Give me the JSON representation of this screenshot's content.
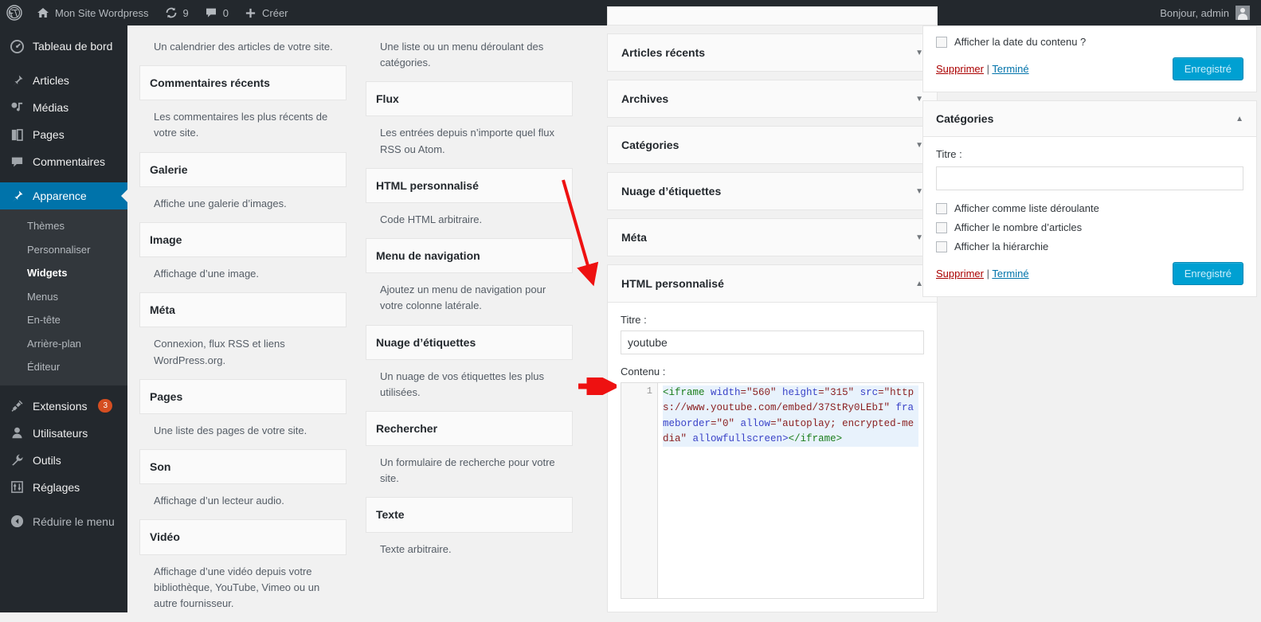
{
  "adminbar": {
    "site_name": "Mon Site Wordpress",
    "updates_count": "9",
    "comments_count": "0",
    "new_label": "Créer",
    "greeting": "Bonjour, admin"
  },
  "sidebar": {
    "items": [
      {
        "label": "Tableau de bord",
        "icon": "dashboard-icon"
      },
      {
        "label": "Articles",
        "icon": "pin-icon"
      },
      {
        "label": "Médias",
        "icon": "media-icon"
      },
      {
        "label": "Pages",
        "icon": "pages-icon"
      },
      {
        "label": "Commentaires",
        "icon": "comment-icon"
      },
      {
        "label": "Apparence",
        "icon": "brush-icon"
      }
    ],
    "appearance_submenu": [
      "Thèmes",
      "Personnaliser",
      "Widgets",
      "Menus",
      "En-tête",
      "Arrière-plan",
      "Éditeur"
    ],
    "current_submenu": "Widgets",
    "items_bottom": [
      {
        "label": "Extensions",
        "icon": "plug-icon",
        "badge": "3"
      },
      {
        "label": "Utilisateurs",
        "icon": "user-icon",
        "badge": ""
      },
      {
        "label": "Outils",
        "icon": "wrench-icon",
        "badge": ""
      },
      {
        "label": "Réglages",
        "icon": "sliders-icon",
        "badge": ""
      }
    ],
    "collapse_label": "Réduire le menu"
  },
  "available_widgets": {
    "left_column": [
      {
        "title": "",
        "desc": "Un calendrier des articles de votre site.",
        "title_hidden": true
      },
      {
        "title": "Commentaires récents",
        "desc": "Les commentaires les plus récents de votre site."
      },
      {
        "title": "Galerie",
        "desc": "Affiche une galerie d’images."
      },
      {
        "title": "Image",
        "desc": "Affichage d’une image."
      },
      {
        "title": "Méta",
        "desc": "Connexion, flux RSS et liens WordPress.org."
      },
      {
        "title": "Pages",
        "desc": "Une liste des pages de votre site."
      },
      {
        "title": "Son",
        "desc": "Affichage d’un lecteur audio."
      },
      {
        "title": "Vidéo",
        "desc": "Affichage d’une vidéo depuis votre bibliothèque, YouTube, Vimeo ou un autre fournisseur."
      }
    ],
    "right_column": [
      {
        "title": "",
        "desc": "Une liste ou un menu déroulant des catégories.",
        "title_hidden": true
      },
      {
        "title": "Flux",
        "desc": "Les entrées depuis n’importe quel flux RSS ou Atom."
      },
      {
        "title": "HTML personnalisé",
        "desc": "Code HTML arbitraire."
      },
      {
        "title": "Menu de navigation",
        "desc": "Ajoutez un menu de navigation pour votre colonne latérale."
      },
      {
        "title": "Nuage d’étiquettes",
        "desc": "Un nuage de vos étiquettes les plus utilisées."
      },
      {
        "title": "Rechercher",
        "desc": "Un formulaire de recherche pour votre site."
      },
      {
        "title": "Texte",
        "desc": "Texte arbitraire."
      }
    ]
  },
  "sidebar_widgets": {
    "collapsed": [
      "Articles récents",
      "Archives",
      "Catégories",
      "Nuage d’étiquettes",
      "Méta"
    ],
    "open_widget": {
      "title": "HTML personnalisé",
      "title_label": "Titre :",
      "title_value": "youtube",
      "content_label": "Contenu :",
      "line_number": "1",
      "code": {
        "t1": "<iframe",
        "a1": " width",
        "v1": "=\"560\"",
        "a2": " height",
        "v2": "=\"315\"",
        "a3": "src",
        "v3": "=\"https://www.youtube.com/embed/37StRy0LEbI\"",
        "a4": " frameborder",
        "v4": "=\"0\"",
        "a5": "allow",
        "v5": "=\"autoplay; encrypted-media\"",
        "a6": "allowfullscreen",
        "p1": ">",
        "t2": "</iframe>"
      },
      "code_plain": "<iframe width=\"560\" height=\"315\" src=\"https://www.youtube.com/embed/37StRy0LEbI\" frameborder=\"0\" allow=\"autoplay; encrypted-media\" allowfullscreen></iframe>"
    }
  },
  "right_panels": {
    "top_partial": {
      "checkbox_label": "Afficher la date du contenu ?",
      "delete_label": "Supprimer",
      "separator": "|",
      "done_label": "Terminé",
      "save_label": "Enregistré"
    },
    "categories": {
      "title": "Catégories",
      "title_label": "Titre :",
      "title_value": "",
      "checkboxes": [
        "Afficher comme liste déroulante",
        "Afficher le nombre d’articles",
        "Afficher la hiérarchie"
      ],
      "delete_label": "Supprimer",
      "separator": "|",
      "done_label": "Terminé",
      "save_label": "Enregistré"
    }
  },
  "colors": {
    "admin_bar": "#23282d",
    "sidebar": "#23282d",
    "accent_blue": "#0073aa",
    "button_blue": "#00a0d2",
    "badge_orange": "#d54e21",
    "annotation_red": "#ee1111",
    "link_red": "#a00",
    "code_highlight": "#e8f2fc"
  }
}
